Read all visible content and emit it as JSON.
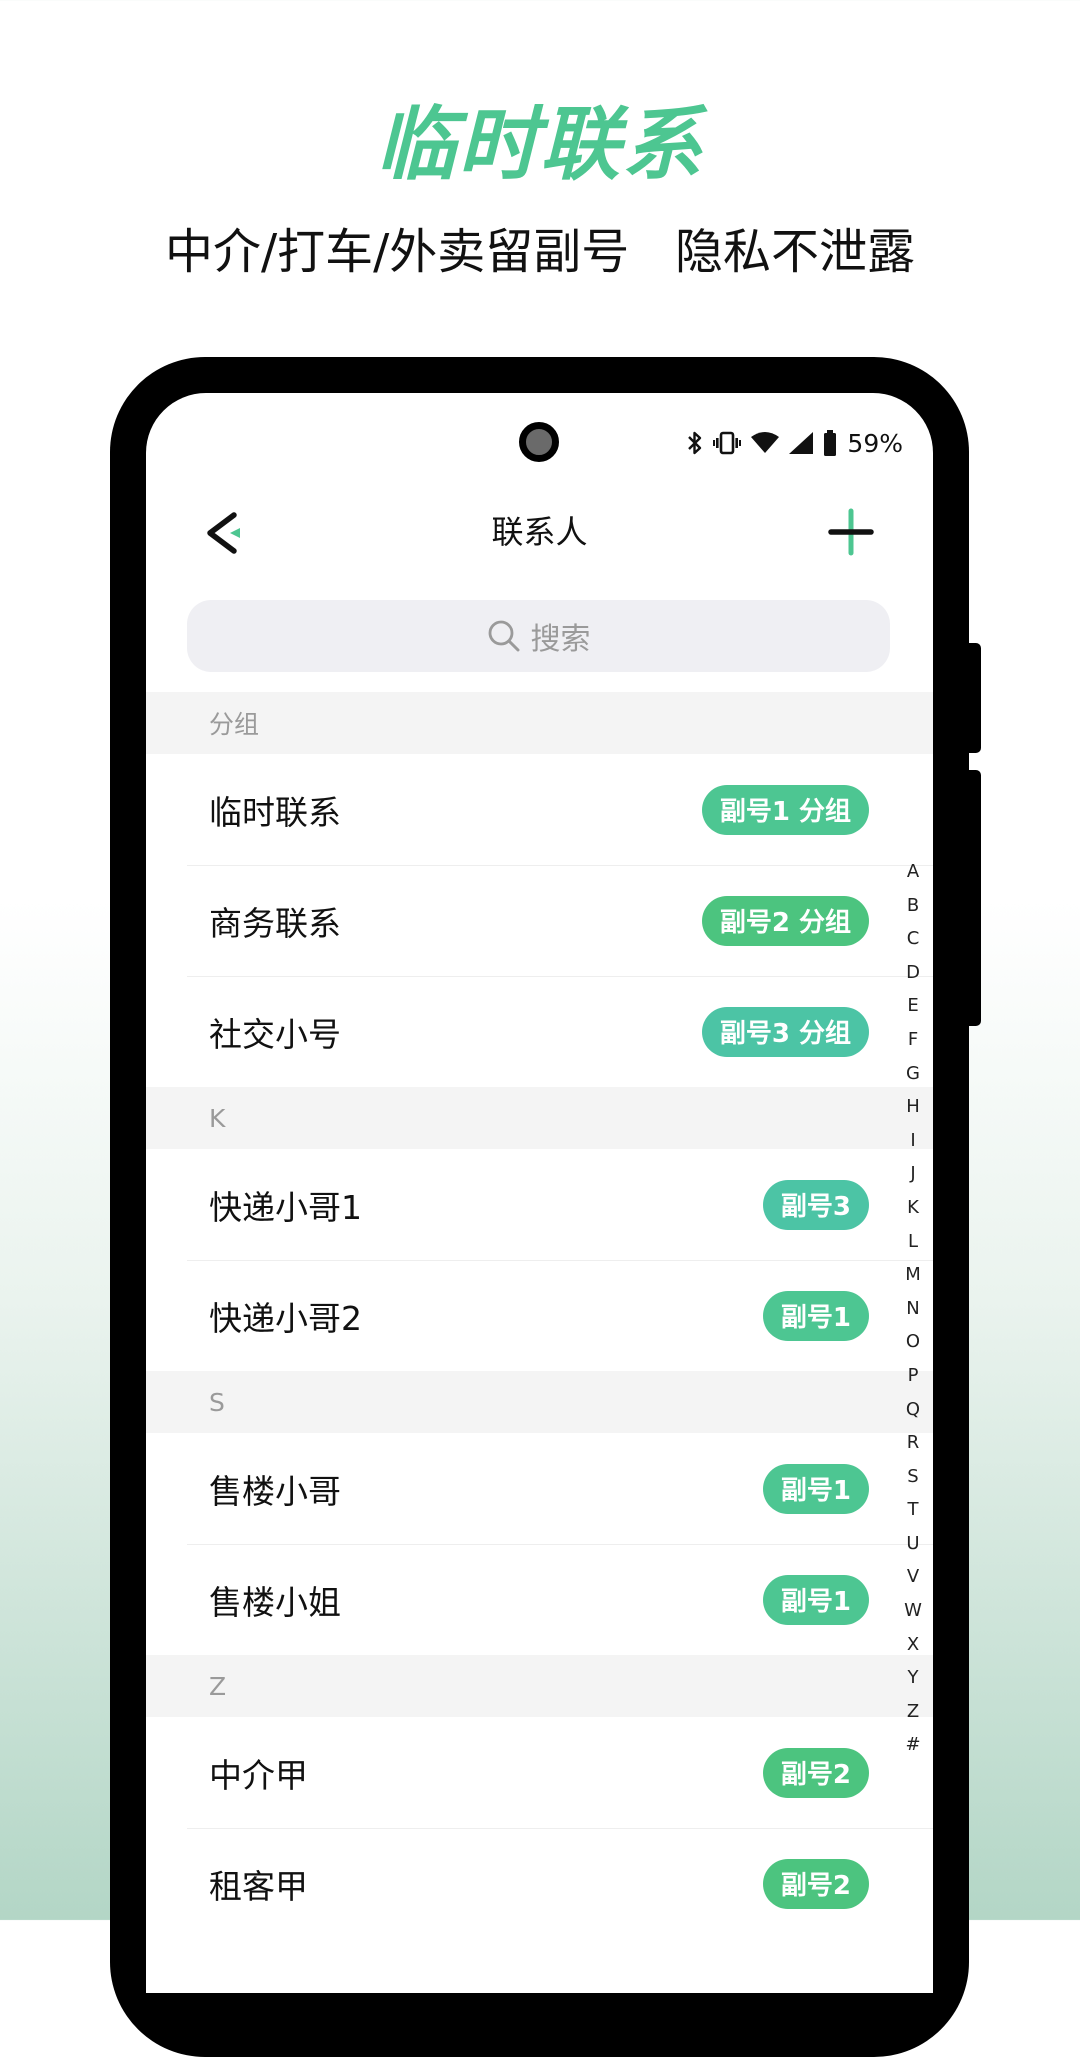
{
  "hero": {
    "title": "临时联系",
    "subtitle": "中介/打车/外卖留副号   隐私不泄露"
  },
  "status_bar": {
    "icons": [
      "bluetooth-icon",
      "vibrate-icon",
      "wifi-icon",
      "cell-signal-icon",
      "battery-icon"
    ],
    "battery": "59%"
  },
  "nav": {
    "title": "联系人",
    "back_icon": "back-chevron-icon",
    "add_icon": "plus-icon"
  },
  "search": {
    "placeholder": "搜索",
    "icon": "search-icon"
  },
  "colors": {
    "accent": "#4dc691",
    "badge_1": "#4dc692",
    "badge_2": "#4cc47f",
    "badge_3": "#4cc4a5",
    "section_bg": "#f4f4f4"
  },
  "sections": [
    {
      "header": "分组",
      "rows": [
        {
          "name": "临时联系",
          "badge": "副号1 分组",
          "badge_type": "1"
        },
        {
          "name": "商务联系",
          "badge": "副号2 分组",
          "badge_type": "2"
        },
        {
          "name": "社交小号",
          "badge": "副号3 分组",
          "badge_type": "3"
        }
      ]
    },
    {
      "header": "K",
      "rows": [
        {
          "name": "快递小哥1",
          "badge": "副号3",
          "badge_type": "3"
        },
        {
          "name": "快递小哥2",
          "badge": "副号1",
          "badge_type": "1"
        }
      ]
    },
    {
      "header": "S",
      "rows": [
        {
          "name": "售楼小哥",
          "badge": "副号1",
          "badge_type": "1"
        },
        {
          "name": "售楼小姐",
          "badge": "副号1",
          "badge_type": "1"
        }
      ]
    },
    {
      "header": "Z",
      "rows": [
        {
          "name": "中介甲",
          "badge": "副号2",
          "badge_type": "2"
        },
        {
          "name": "租客甲",
          "badge": "副号2",
          "badge_type": "2"
        }
      ]
    }
  ],
  "index_letters": [
    "A",
    "B",
    "C",
    "D",
    "E",
    "F",
    "G",
    "H",
    "I",
    "J",
    "K",
    "L",
    "M",
    "N",
    "O",
    "P",
    "Q",
    "R",
    "S",
    "T",
    "U",
    "V",
    "W",
    "X",
    "Y",
    "Z",
    "#"
  ]
}
